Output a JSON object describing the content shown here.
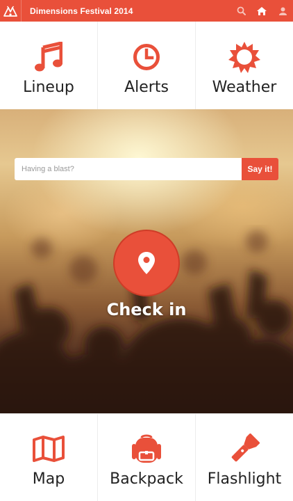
{
  "app": {
    "title": "Dimensions Festival 2014",
    "accent_color": "#e9503a"
  },
  "topbar": {
    "logo_icon": "festival-logo-icon",
    "icons": [
      "search-icon",
      "home-icon",
      "user-icon"
    ]
  },
  "top_menu": [
    {
      "label": "Lineup",
      "icon": "music-note-icon"
    },
    {
      "label": "Alerts",
      "icon": "clock-icon"
    },
    {
      "label": "Weather",
      "icon": "sun-icon"
    }
  ],
  "blast": {
    "placeholder": "Having a blast?",
    "button_label": "Say it!"
  },
  "checkin": {
    "label": "Check in",
    "icon": "map-pin-icon"
  },
  "bottom_menu": [
    {
      "label": "Map",
      "icon": "map-icon"
    },
    {
      "label": "Backpack",
      "icon": "backpack-icon"
    },
    {
      "label": "Flashlight",
      "icon": "flashlight-icon"
    }
  ]
}
